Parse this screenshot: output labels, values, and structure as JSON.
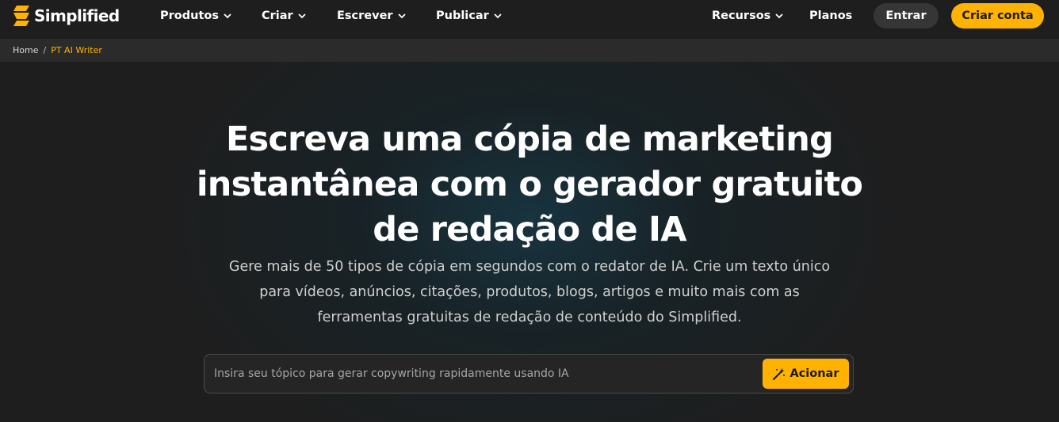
{
  "brand": {
    "name": "Simplified",
    "accent": "#ffb300"
  },
  "nav": {
    "produtos": "Produtos",
    "criar": "Criar",
    "escrever": "Escrever",
    "publicar": "Publicar",
    "recursos": "Recursos",
    "planos": "Planos",
    "entrar": "Entrar",
    "criar_conta": "Criar conta"
  },
  "breadcrumb": {
    "home": "Home",
    "separator": "/",
    "current": "PT AI Writer"
  },
  "hero": {
    "title_lines": [
      "Escreva uma cópia de marketing",
      "instantânea com o gerador gratuito",
      "de redação de IA"
    ],
    "subtitle_lines": [
      "Gere mais de 50 tipos de cópia em segundos com o redator de IA. Crie um texto único",
      "para vídeos, anúncios, citações, produtos, blogs, artigos e muito mais com as",
      "ferramentas gratuitas de redação de conteúdo do Simplified."
    ]
  },
  "search": {
    "placeholder": "Insira seu tópico para gerar copywriting rapidamente usando IA",
    "value": "",
    "button_label": "Acionar",
    "button_icon": "magic-wand-icon"
  }
}
